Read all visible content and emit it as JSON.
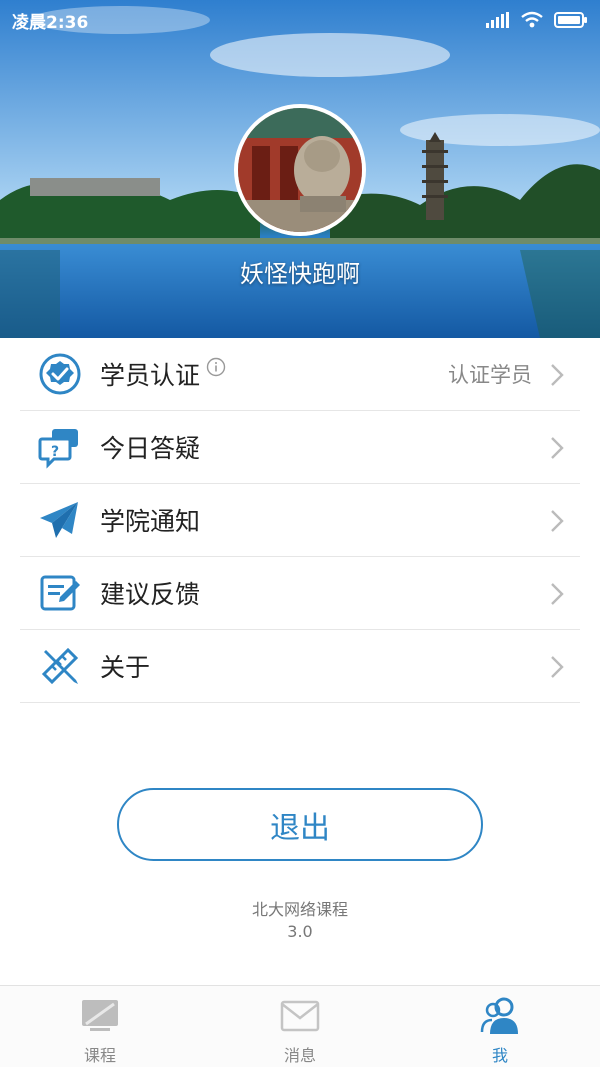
{
  "status_bar": {
    "time": "凌晨2:36"
  },
  "profile": {
    "username": "妖怪快跑啊"
  },
  "menu": {
    "items": [
      {
        "label": "学员认证",
        "value": "认证学员",
        "icon": "verified-badge-icon",
        "has_info": true
      },
      {
        "label": "今日答疑",
        "value": "",
        "icon": "question-chat-icon",
        "has_info": false
      },
      {
        "label": "学院通知",
        "value": "",
        "icon": "paper-plane-icon",
        "has_info": false
      },
      {
        "label": "建议反馈",
        "value": "",
        "icon": "edit-note-icon",
        "has_info": false
      },
      {
        "label": "关于",
        "value": "",
        "icon": "pencil-ruler-icon",
        "has_info": false
      }
    ]
  },
  "logout": {
    "label": "退出"
  },
  "footer": {
    "app_name": "北大网络课程",
    "version": "3.0"
  },
  "tabbar": {
    "tabs": [
      {
        "label": "课程",
        "icon": "monitor-icon",
        "active": false
      },
      {
        "label": "消息",
        "icon": "envelope-icon",
        "active": false
      },
      {
        "label": "我",
        "icon": "user-group-icon",
        "active": true
      }
    ]
  },
  "colors": {
    "accent": "#2f86c5",
    "text": "#222222",
    "muted": "#888888",
    "divider": "#e6e6e6"
  }
}
